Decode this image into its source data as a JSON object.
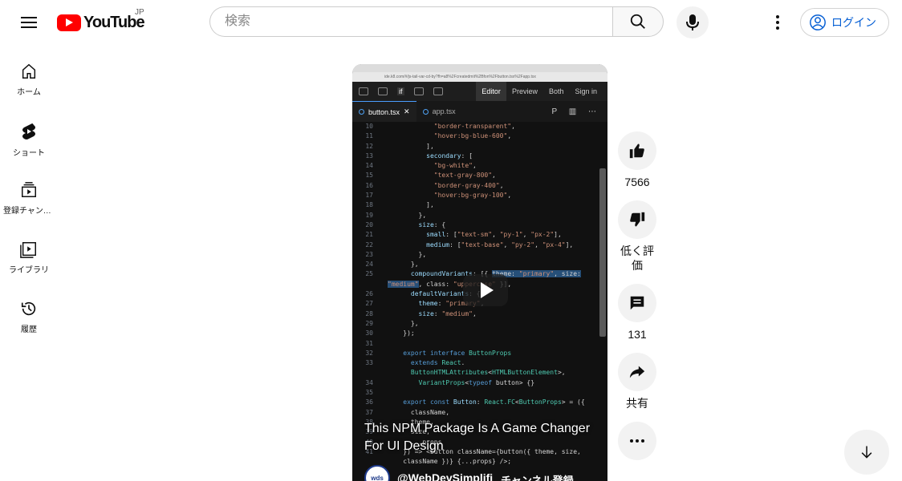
{
  "header": {
    "logo_text": "YouTube",
    "country_code": "JP",
    "search_placeholder": "検索",
    "login_label": "ログイン"
  },
  "sidebar": {
    "items": [
      {
        "label": "ホーム",
        "icon": "home-icon"
      },
      {
        "label": "ショート",
        "icon": "shorts-icon"
      },
      {
        "label": "登録チャンネル",
        "icon": "subscriptions-icon"
      },
      {
        "label": "ライブラリ",
        "icon": "library-icon"
      },
      {
        "label": "履歴",
        "icon": "history-icon"
      }
    ]
  },
  "video": {
    "title": "This NPM Package Is A Game Changer For UI Design",
    "channel": "@WebDevSimplifi",
    "channel_avatar_text": "wds",
    "subscribe_label": "チャンネル登録",
    "editor": {
      "toolbar_left": "if",
      "toolbar_right": [
        "Editor",
        "Preview",
        "Both",
        "Sign in"
      ],
      "tabs": [
        "button.tsx",
        "app.tsx"
      ],
      "address": "ide.k8.com/#/js-tail-var-cd-by?fh=a8%2Fcreatedmit%2Bfon%2Fbutton.tsx%2Fapp.tsx"
    },
    "code_lines": [
      {
        "n": "10",
        "html": "            <span class='s'>\"border-transparent\"</span>,"
      },
      {
        "n": "11",
        "html": "            <span class='s'>\"hover:bg-blue-600\"</span>,"
      },
      {
        "n": "12",
        "html": "          ],"
      },
      {
        "n": "13",
        "html": "          <span class='p'>secondary</span>: ["
      },
      {
        "n": "14",
        "html": "            <span class='s'>\"bg-white\"</span>,"
      },
      {
        "n": "15",
        "html": "            <span class='s'>\"text-gray-800\"</span>,"
      },
      {
        "n": "16",
        "html": "            <span class='s'>\"border-gray-400\"</span>,"
      },
      {
        "n": "17",
        "html": "            <span class='s'>\"hover:bg-gray-100\"</span>,"
      },
      {
        "n": "18",
        "html": "          ],"
      },
      {
        "n": "19",
        "html": "        },"
      },
      {
        "n": "20",
        "html": "        <span class='p'>size</span>: {"
      },
      {
        "n": "21",
        "html": "          <span class='p'>small</span>: [<span class='s'>\"text-sm\"</span>, <span class='s'>\"py-1\"</span>, <span class='s'>\"px-2\"</span>],"
      },
      {
        "n": "22",
        "html": "          <span class='p'>medium</span>: [<span class='s'>\"text-base\"</span>, <span class='s'>\"py-2\"</span>, <span class='s'>\"px-4\"</span>],"
      },
      {
        "n": "23",
        "html": "        },"
      },
      {
        "n": "24",
        "html": "      },"
      },
      {
        "n": "25",
        "html": "      <span class='p'>compoundVariants</span>: [{ <span class='hl'>theme: <span class='s'>\"primary\"</span>, size:</span>"
      },
      {
        "n": "",
        "html": "<span class='hl'><span class='s'>\"medium\"</span></span>, class: <span class='s'>\"uppercase\"</span> }],"
      },
      {
        "n": "26",
        "html": "      <span class='p'>defaultVariants</span>: {"
      },
      {
        "n": "27",
        "html": "        <span class='p'>theme</span>: <span class='s'>\"primary\"</span>,"
      },
      {
        "n": "28",
        "html": "        <span class='p'>size</span>: <span class='s'>\"medium\"</span>,"
      },
      {
        "n": "29",
        "html": "      },"
      },
      {
        "n": "30",
        "html": "    });"
      },
      {
        "n": "31",
        "html": ""
      },
      {
        "n": "32",
        "html": "    <span class='k'>export interface</span> <span class='t'>ButtonProps</span>"
      },
      {
        "n": "33",
        "html": "      <span class='k'>extends</span> <span class='t'>React</span>."
      },
      {
        "n": "",
        "html": "      <span class='t'>ButtonHTMLAttributes</span>&lt;<span class='t'>HTMLButtonElement</span>&gt;,"
      },
      {
        "n": "34",
        "html": "        <span class='t'>VariantProps</span>&lt;<span class='k'>typeof</span> button&gt; {}"
      },
      {
        "n": "35",
        "html": ""
      },
      {
        "n": "36",
        "html": "    <span class='k'>export const</span> <span class='p'>Button</span>: <span class='t'>React.FC</span>&lt;<span class='t'>ButtonProps</span>&gt; = ({"
      },
      {
        "n": "37",
        "html": "      className,"
      },
      {
        "n": "38",
        "html": "      theme,"
      },
      {
        "n": "39",
        "html": "      size,"
      },
      {
        "n": "40",
        "html": "      ...props"
      },
      {
        "n": "41",
        "html": "    }) => &lt;button className={button({ theme, size,"
      },
      {
        "n": "",
        "html": "    className })} {...props} /&gt;;"
      }
    ]
  },
  "actions": {
    "like_count": "7566",
    "dislike_label": "低く評価",
    "comment_count": "131",
    "share_label": "共有"
  }
}
